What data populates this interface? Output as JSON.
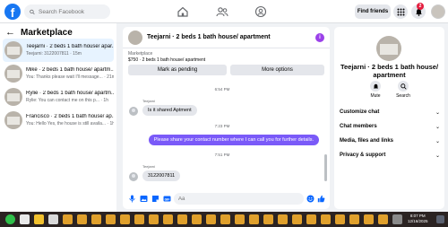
{
  "header": {
    "logo": "f",
    "search_placeholder": "Search Facebook",
    "find_friends": "Find friends",
    "notification_count": "2",
    "nav_icons": [
      "home-icon",
      "friends-icon",
      "groups-icon"
    ]
  },
  "sidebar": {
    "title": "Marketplace",
    "back_icon": "arrow-left-icon",
    "conversations": [
      {
        "name": "Teejarni · 2 beds 1 bath house/ apar...",
        "preview": "Teejarni: 3122007811 · 15m",
        "active": true
      },
      {
        "name": "Mike · 2 beds 1 bath house/ apartm...",
        "preview": "You: Thanks please wait I'll message... · 21m",
        "active": false
      },
      {
        "name": "Rylie · 2 beds 1 bath house/ apartm...",
        "preview": "Rylie: You can contact me on this p... · 1h",
        "active": false
      },
      {
        "name": "Francisco · 2 beds 1 bath house/ ap...",
        "preview": "You: Hello Yes, the house is still availa... · 1h",
        "active": false
      }
    ]
  },
  "chat": {
    "title": "Teejarni · 2 beds 1 bath house/ apartment",
    "info_icon": "i",
    "marketplace_label": "Marketplace",
    "listing": "$750 · 2 beds 1 bath house/ apartment",
    "mark_pending": "Mark as pending",
    "more_options": "More options",
    "messages": [
      {
        "kind": "timestamp",
        "text": "6:54 PM"
      },
      {
        "kind": "sender",
        "text": "Teejarni"
      },
      {
        "kind": "in",
        "text": "Is it shared Aptment"
      },
      {
        "kind": "timestamp",
        "text": "7:23 PM"
      },
      {
        "kind": "out",
        "text": "Please share your contact number where I can call you for further details."
      },
      {
        "kind": "timestamp",
        "text": "7:51 PM"
      },
      {
        "kind": "sender",
        "text": "Teejarni"
      },
      {
        "kind": "in",
        "text": "3122007811"
      }
    ],
    "composer_placeholder": "Aa"
  },
  "right_panel": {
    "title": "Teejarni · 2 beds 1 bath house/ apartment",
    "mute": "Mute",
    "search": "Search",
    "sections": [
      "Customize chat",
      "Chat members",
      "Media, files and links",
      "Privacy & support"
    ]
  },
  "taskbar": {
    "time": "8:07 PM",
    "date": "12/16/2025"
  },
  "colors": {
    "brand": "#1877f2",
    "outgoing_bubble": "#7a5af8",
    "info": "#9b41e9",
    "badge": "#e41e3f"
  }
}
